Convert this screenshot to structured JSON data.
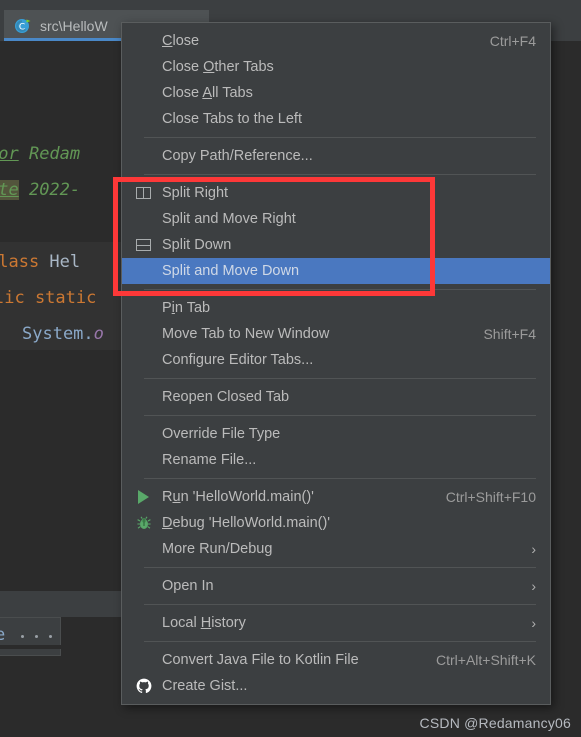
{
  "window": {
    "theme_bg": "#2b2b2b",
    "panel_bg": "#3c3f41",
    "accent": "#4a78c0",
    "annotation_color": "#fd3838"
  },
  "tab": {
    "label": "src\\HelloW",
    "icon": "java-class-icon"
  },
  "editor": {
    "lines": [
      {
        "segments": [
          {
            "text": "hor",
            "style": "tag"
          },
          {
            "text": " Redam",
            "style": "doc"
          }
        ]
      },
      {
        "segments": [
          {
            "text": "ate",
            "style": "date"
          },
          {
            "text": " 2022-",
            "style": "doc"
          }
        ]
      },
      {
        "segments": [
          {
            "text": "class",
            "style": "kw"
          },
          {
            "text": " Hel",
            "style": "cls"
          }
        ]
      },
      {
        "segments": [
          {
            "text": "lic static",
            "style": "kw"
          }
        ]
      },
      {
        "segments": [
          {
            "text": "System.",
            "style": "type"
          },
          {
            "text": "o",
            "style": "field"
          }
        ]
      }
    ],
    "mini_popup": {
      "text": "e",
      "dots": "· · ·"
    }
  },
  "context_menu": {
    "groups": [
      {
        "items": [
          {
            "label": "Close",
            "mnemonic": "C",
            "accel": "Ctrl+F4",
            "icon": null,
            "submenu": false,
            "selected": false
          },
          {
            "label": "Close Other Tabs",
            "mnemonic": "O",
            "accel": "",
            "icon": null,
            "submenu": false,
            "selected": false
          },
          {
            "label": "Close All Tabs",
            "mnemonic": "A",
            "accel": "",
            "icon": null,
            "submenu": false,
            "selected": false
          },
          {
            "label": "Close Tabs to the Left",
            "mnemonic": "",
            "accel": "",
            "icon": null,
            "submenu": false,
            "selected": false
          }
        ]
      },
      {
        "items": [
          {
            "label": "Copy Path/Reference...",
            "mnemonic": "",
            "accel": "",
            "icon": null,
            "submenu": false,
            "selected": false
          }
        ]
      },
      {
        "items": [
          {
            "label": "Split Right",
            "mnemonic": "",
            "accel": "",
            "icon": "split-vertical-icon",
            "submenu": false,
            "selected": false
          },
          {
            "label": "Split and Move Right",
            "mnemonic": "",
            "accel": "",
            "icon": null,
            "submenu": false,
            "selected": false
          },
          {
            "label": "Split Down",
            "mnemonic": "",
            "accel": "",
            "icon": "split-horizontal-icon",
            "submenu": false,
            "selected": false
          },
          {
            "label": "Split and Move Down",
            "mnemonic": "",
            "accel": "",
            "icon": null,
            "submenu": false,
            "selected": true
          }
        ]
      },
      {
        "items": [
          {
            "label": "Pin Tab",
            "mnemonic": "i",
            "accel": "",
            "icon": null,
            "submenu": false,
            "selected": false
          },
          {
            "label": "Move Tab to New Window",
            "mnemonic": "",
            "accel": "Shift+F4",
            "icon": null,
            "submenu": false,
            "selected": false
          },
          {
            "label": "Configure Editor Tabs...",
            "mnemonic": "",
            "accel": "",
            "icon": null,
            "submenu": false,
            "selected": false
          }
        ]
      },
      {
        "items": [
          {
            "label": "Reopen Closed Tab",
            "mnemonic": "",
            "accel": "",
            "icon": null,
            "submenu": false,
            "selected": false
          }
        ]
      },
      {
        "items": [
          {
            "label": "Override File Type",
            "mnemonic": "",
            "accel": "",
            "icon": null,
            "submenu": false,
            "selected": false
          },
          {
            "label": "Rename File...",
            "mnemonic": "",
            "accel": "",
            "icon": null,
            "submenu": false,
            "selected": false
          }
        ]
      },
      {
        "items": [
          {
            "label": "Run 'HelloWorld.main()'",
            "mnemonic": "u",
            "accel": "Ctrl+Shift+F10",
            "icon": "run-icon",
            "submenu": false,
            "selected": false
          },
          {
            "label": "Debug 'HelloWorld.main()'",
            "mnemonic": "D",
            "accel": "",
            "icon": "debug-bug-icon",
            "submenu": false,
            "selected": false
          },
          {
            "label": "More Run/Debug",
            "mnemonic": "",
            "accel": "",
            "icon": null,
            "submenu": true,
            "selected": false
          }
        ]
      },
      {
        "items": [
          {
            "label": "Open In",
            "mnemonic": "",
            "accel": "",
            "icon": null,
            "submenu": true,
            "selected": false
          }
        ]
      },
      {
        "items": [
          {
            "label": "Local History",
            "mnemonic": "H",
            "accel": "",
            "icon": null,
            "submenu": true,
            "selected": false
          }
        ]
      },
      {
        "items": [
          {
            "label": "Convert Java File to Kotlin File",
            "mnemonic": "",
            "accel": "Ctrl+Alt+Shift+K",
            "icon": null,
            "submenu": false,
            "selected": false
          },
          {
            "label": "Create Gist...",
            "mnemonic": "",
            "accel": "",
            "icon": "github-icon",
            "submenu": false,
            "selected": false
          }
        ]
      }
    ],
    "submenu_arrow": "›"
  },
  "annotation": {
    "type": "red-rectangle-highlight",
    "targets": [
      "Split Right",
      "Split and Move Right",
      "Split Down",
      "Split and Move Down"
    ]
  },
  "watermark": {
    "text": "CSDN @Redamancy06"
  }
}
